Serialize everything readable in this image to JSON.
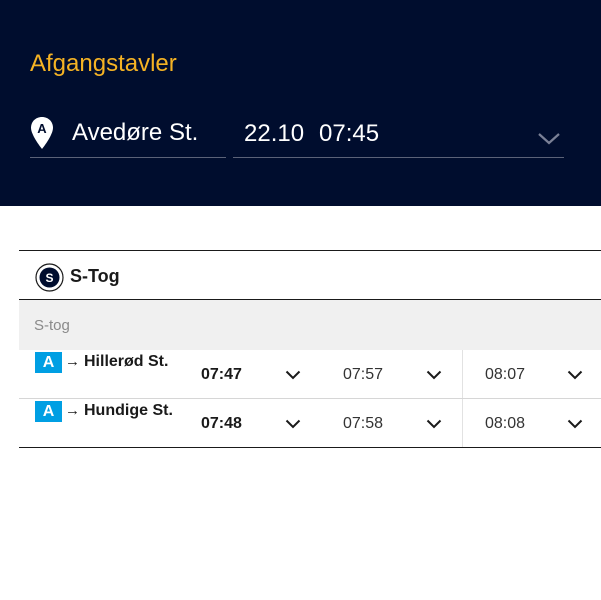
{
  "header": {
    "title": "Afgangstavler",
    "station": "Avedøre St.",
    "date": "22.10",
    "time": "07:45",
    "station_icon_letter": "A"
  },
  "section": {
    "icon": "s-tog-logo-icon",
    "title": "S-Tog",
    "subheader": "S-tog",
    "rows": [
      {
        "line": "A",
        "arrow": "→",
        "destination": "Hillerød St.",
        "times": [
          "07:47",
          "07:57",
          "08:07"
        ]
      },
      {
        "line": "A",
        "arrow": "→",
        "destination": "Hundige St.",
        "times": [
          "07:48",
          "07:58",
          "08:08"
        ]
      }
    ]
  },
  "colors": {
    "header_bg": "#000d2e",
    "title_accent": "#f5b324",
    "line_badge": "#009fe3"
  }
}
